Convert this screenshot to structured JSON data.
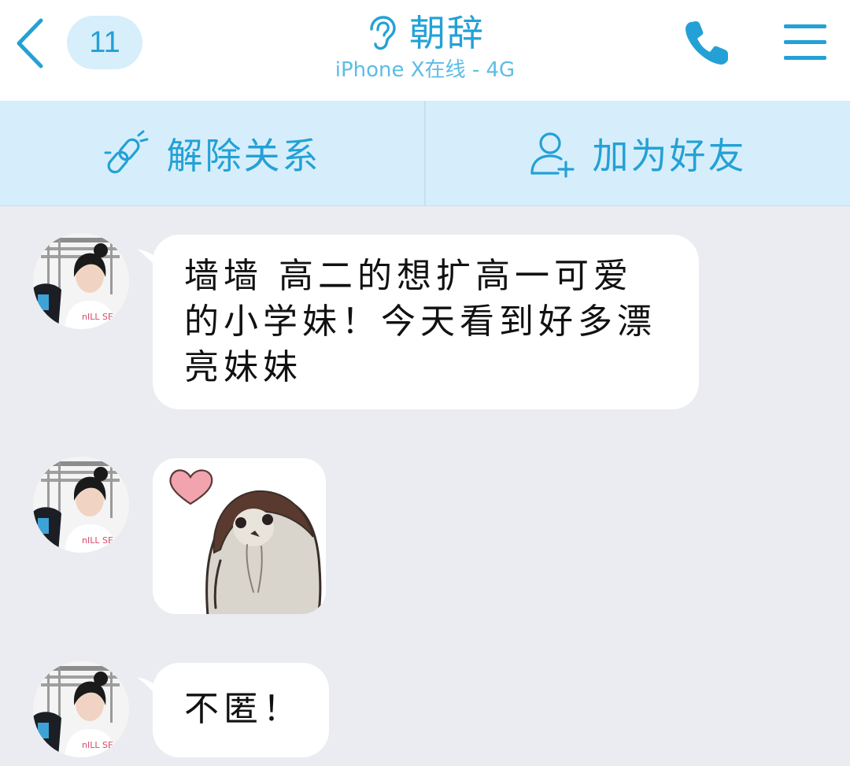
{
  "header": {
    "back_icon": "chevron-left-icon",
    "unread_count": "11",
    "contact_name": "朝辞",
    "status": "iPhone X在线 - 4G",
    "ear_icon": "ear-icon",
    "call_icon": "phone-icon",
    "menu_icon": "hamburger-menu-icon"
  },
  "actions": {
    "unlink_label": "解除关系",
    "unlink_icon": "broken-link-icon",
    "add_friend_label": "加为好友",
    "add_friend_icon": "add-user-icon"
  },
  "messages": [
    {
      "type": "text",
      "lines": [
        "墙墙 高二的想扩高一可爱",
        "的小学妹！今天看到好多漂",
        "亮妹妹"
      ]
    },
    {
      "type": "sticker",
      "sticker": "penguin-with-heart-sticker"
    },
    {
      "type": "text",
      "lines": [
        "不匿！"
      ]
    }
  ],
  "colors": {
    "accent": "#23a1d6",
    "action_bar_bg": "#d6eefb",
    "chat_bg": "#ebecf1",
    "bubble_bg": "#ffffff"
  }
}
